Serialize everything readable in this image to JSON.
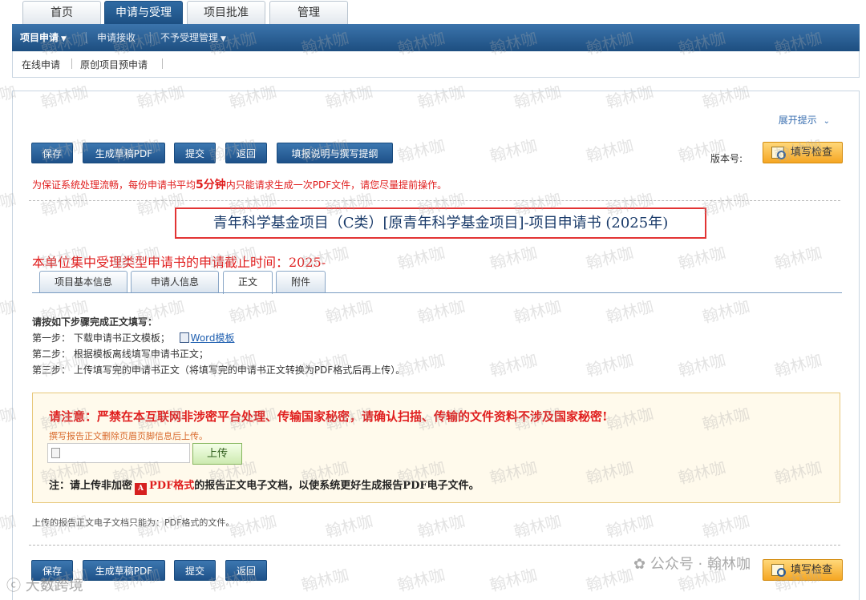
{
  "top_tabs": [
    {
      "label": "首页",
      "active": false
    },
    {
      "label": "申请与受理",
      "active": true
    },
    {
      "label": "项目批准",
      "active": false
    },
    {
      "label": "管理",
      "active": false
    }
  ],
  "subnav": [
    {
      "label": "项目申请",
      "dropdown": true,
      "active": true
    },
    {
      "label": "申请接收",
      "dropdown": false,
      "active": false
    },
    {
      "label": "不予受理管理",
      "dropdown": true,
      "active": false
    }
  ],
  "breadcrumb": [
    "在线申请",
    "原创项目预申请"
  ],
  "expand_tip": "展开提示",
  "toolbar": {
    "save": "保存",
    "draft_pdf": "生成草稿PDF",
    "submit": "提交",
    "back": "返回",
    "guide": "填报说明与撰写提纲",
    "version_label": "版本号:",
    "check": "填写检查"
  },
  "notice": {
    "before": "为保证系统处理流畅，每份申请书平均",
    "highlight": "5分钟",
    "after": "内只能请求生成一次PDF文件，请您尽量提前操作。"
  },
  "form_title": "青年科学基金项目（C类）[原青年科学基金项目]-项目申请书 (2025年)",
  "deadline": "本单位集中受理类型申请书的申请截止时间：2025-",
  "content_tabs": [
    {
      "label": "项目基本信息",
      "active": false
    },
    {
      "label": "申请人信息",
      "active": false
    },
    {
      "label": "正文",
      "active": true
    },
    {
      "label": "附件",
      "active": false
    }
  ],
  "steps": {
    "heading": "请按如下步骤完成正文填写：",
    "step1": "第一步： 下载申请书正文模板；",
    "word_link": "Word模板",
    "step2": "第二步： 根据模板离线填写申请书正文；",
    "step3": "第三步： 上传填写完的申请书正文（将填写完的申请书正文转换为PDF格式后再上传）。"
  },
  "warning": {
    "title": "请注意：严禁在本互联网非涉密平台处理、传输国家秘密，请确认扫描、传输的文件资料不涉及国家秘密!",
    "sub": "撰写报告正文删除页眉页脚信息后上传。",
    "upload_label": "上传",
    "note_before": "注：请上传非加密",
    "note_pdf": "PDF格式",
    "note_after": "的报告正文电子文档，以使系统更好生成报告PDF电子文件。"
  },
  "upload_hint": "上传的报告正文电子文档只能为：PDF格式的文件。",
  "watermark": "翰林咖",
  "corner_left": "大数跨境",
  "corner_right": "公众号 · 翰林咖",
  "colors": {
    "nav_blue": "#1d4e80",
    "accent_red": "#e01e1e",
    "check_orange": "#f5a623"
  }
}
